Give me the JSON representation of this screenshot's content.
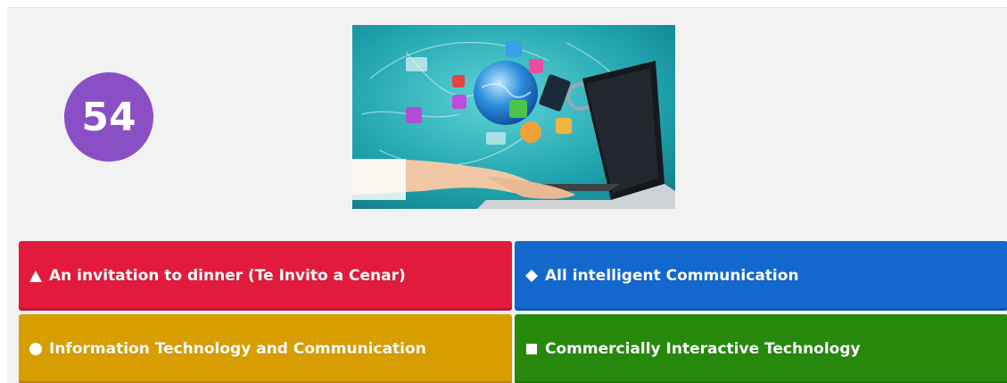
{
  "question": {
    "timer_value": "54"
  },
  "media": {
    "icon": "laptop-technology-illustration"
  },
  "answers": [
    {
      "shape": "triangle-icon",
      "label": "An invitation to dinner (Te Invito a Cenar)",
      "color": "#e21b3c"
    },
    {
      "shape": "diamond-icon",
      "label": "All intelligent Communication",
      "color": "#1368ce"
    },
    {
      "shape": "circle-icon",
      "label": "Information Technology and Communication",
      "color": "#d89e00"
    },
    {
      "shape": "square-icon",
      "label": "Commercially Interactive Technology",
      "color": "#26890c"
    }
  ],
  "colors": {
    "timer_bg": "#8a4fc4",
    "stage_bg": "#f2f2f2"
  }
}
